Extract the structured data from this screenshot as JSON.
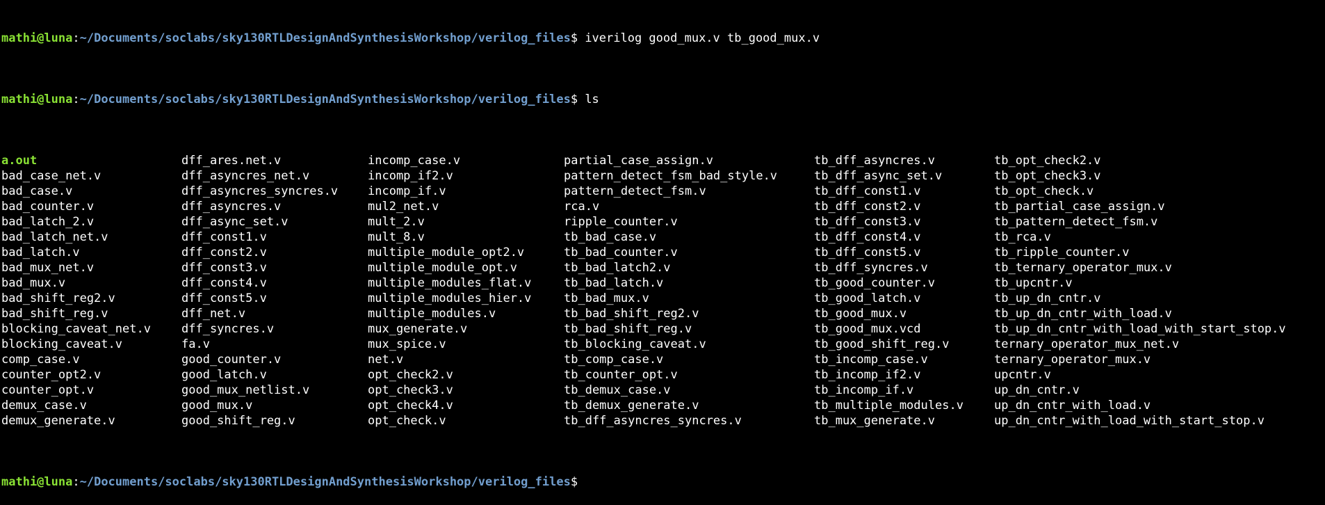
{
  "colors": {
    "background": "#000000",
    "prompt_user": "#8ae234",
    "prompt_path": "#729fcf",
    "text": "#ffffff",
    "executable": "#8ae234"
  },
  "prompt": {
    "user_host": "mathi@luna",
    "separator": ":",
    "path": "~/Documents/soclabs/sky130RTLDesignAndSynthesisWorkshop/verilog_files",
    "dollar": "$"
  },
  "commands": [
    {
      "text": " iverilog good_mux.v tb_good_mux.v"
    },
    {
      "text": " ls"
    },
    {
      "text": ""
    }
  ],
  "ls_columns": [
    [
      "a.out",
      "bad_case_net.v",
      "bad_case.v",
      "bad_counter.v",
      "bad_latch_2.v",
      "bad_latch_net.v",
      "bad_latch.v",
      "bad_mux_net.v",
      "bad_mux.v",
      "bad_shift_reg2.v",
      "bad_shift_reg.v",
      "blocking_caveat_net.v",
      "blocking_caveat.v",
      "comp_case.v",
      "counter_opt2.v",
      "counter_opt.v",
      "demux_case.v",
      "demux_generate.v"
    ],
    [
      "dff_ares.net.v",
      "dff_asyncres_net.v",
      "dff_asyncres_syncres.v",
      "dff_asyncres.v",
      "dff_async_set.v",
      "dff_const1.v",
      "dff_const2.v",
      "dff_const3.v",
      "dff_const4.v",
      "dff_const5.v",
      "dff_net.v",
      "dff_syncres.v",
      "fa.v",
      "good_counter.v",
      "good_latch.v",
      "good_mux_netlist.v",
      "good_mux.v",
      "good_shift_reg.v"
    ],
    [
      "incomp_case.v",
      "incomp_if2.v",
      "incomp_if.v",
      "mul2_net.v",
      "mult_2.v",
      "mult_8.v",
      "multiple_module_opt2.v",
      "multiple_module_opt.v",
      "multiple_modules_flat.v",
      "multiple_modules_hier.v",
      "multiple_modules.v",
      "mux_generate.v",
      "mux_spice.v",
      "net.v",
      "opt_check2.v",
      "opt_check3.v",
      "opt_check4.v",
      "opt_check.v"
    ],
    [
      "partial_case_assign.v",
      "pattern_detect_fsm_bad_style.v",
      "pattern_detect_fsm.v",
      "rca.v",
      "ripple_counter.v",
      "tb_bad_case.v",
      "tb_bad_counter.v",
      "tb_bad_latch2.v",
      "tb_bad_latch.v",
      "tb_bad_mux.v",
      "tb_bad_shift_reg2.v",
      "tb_bad_shift_reg.v",
      "tb_blocking_caveat.v",
      "tb_comp_case.v",
      "tb_counter_opt.v",
      "tb_demux_case.v",
      "tb_demux_generate.v",
      "tb_dff_asyncres_syncres.v"
    ],
    [
      "tb_dff_asyncres.v",
      "tb_dff_async_set.v",
      "tb_dff_const1.v",
      "tb_dff_const2.v",
      "tb_dff_const3.v",
      "tb_dff_const4.v",
      "tb_dff_const5.v",
      "tb_dff_syncres.v",
      "tb_good_counter.v",
      "tb_good_latch.v",
      "tb_good_mux.v",
      "tb_good_mux.vcd",
      "tb_good_shift_reg.v",
      "tb_incomp_case.v",
      "tb_incomp_if2.v",
      "tb_incomp_if.v",
      "tb_multiple_modules.v",
      "tb_mux_generate.v"
    ],
    [
      "tb_opt_check2.v",
      "tb_opt_check3.v",
      "tb_opt_check.v",
      "tb_partial_case_assign.v",
      "tb_pattern_detect_fsm.v",
      "tb_rca.v",
      "tb_ripple_counter.v",
      "tb_ternary_operator_mux.v",
      "tb_upcntr.v",
      "tb_up_dn_cntr.v",
      "tb_up_dn_cntr_with_load.v",
      "tb_up_dn_cntr_with_load_with_start_stop.v",
      "ternary_operator_mux_net.v",
      "ternary_operator_mux.v",
      "upcntr.v",
      "up_dn_cntr.v",
      "up_dn_cntr_with_load.v",
      "up_dn_cntr_with_load_with_start_stop.v"
    ]
  ],
  "executables": [
    "a.out"
  ]
}
